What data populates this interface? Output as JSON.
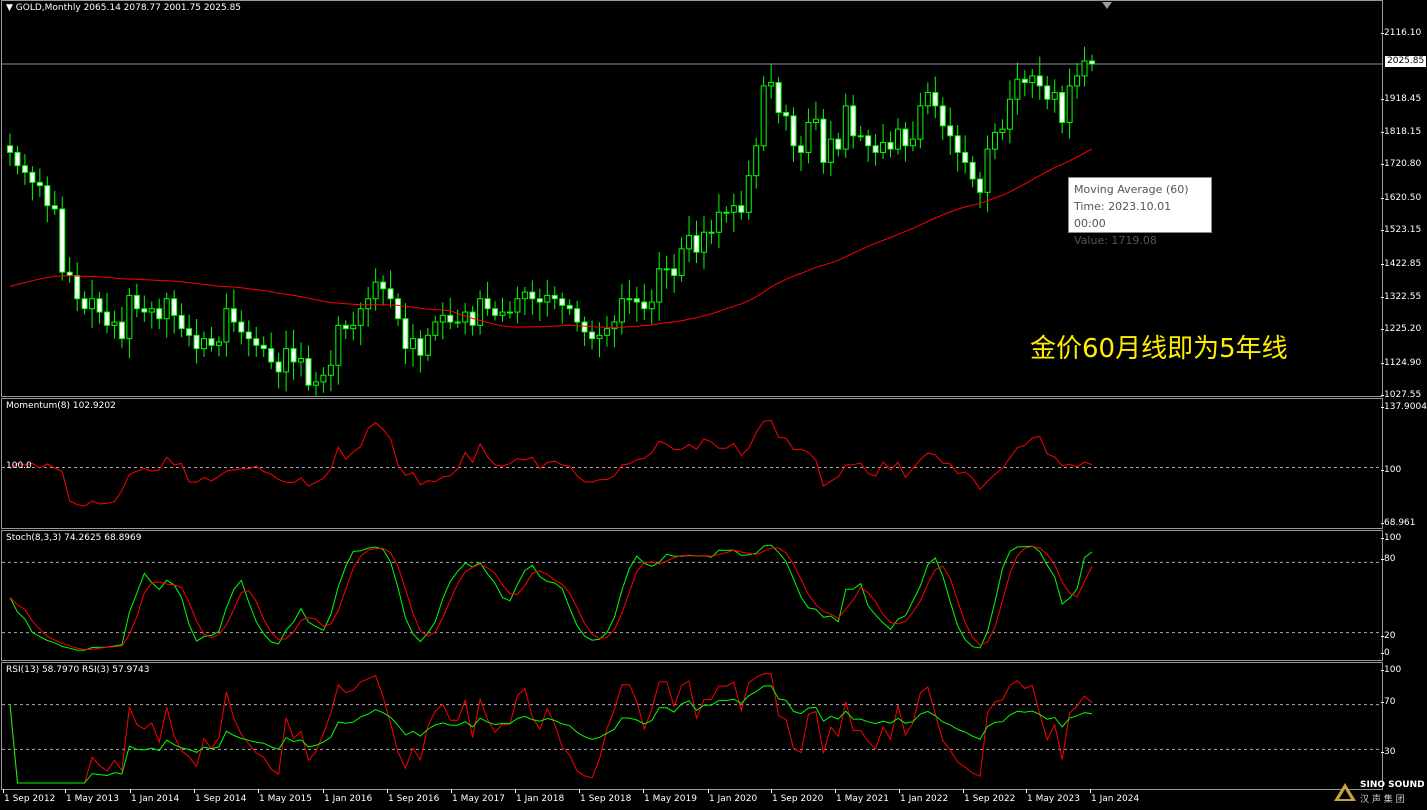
{
  "main": {
    "symbol_label": "GOLD,Monthly",
    "ohlc_label": "2065.14 2078.77 2001.75 2025.85",
    "current_price": "2025.85",
    "price_ticks": [
      "2116.10",
      "1918.45",
      "1818.15",
      "1720.80",
      "1620.50",
      "1523.15",
      "1422.85",
      "1322.55",
      "1225.20",
      "1124.90",
      "1027.55"
    ],
    "tooltip": {
      "line1": "Moving Average (60)",
      "line2": "Time: 2023.10.01 00:00",
      "line3": "Value: 1719.08"
    },
    "annotation": "金价60月线即为5年线"
  },
  "momentum": {
    "label": "Momentum(8) 102.9202",
    "ref_label": "100.0",
    "ticks": [
      "137.9004",
      "100",
      "68.961"
    ]
  },
  "stoch": {
    "label": "Stoch(8,3,3) 74.2625 68.8969",
    "ticks": [
      "100",
      "80",
      "20",
      "0"
    ]
  },
  "rsi": {
    "label": "RSI(13) 58.7970  RSI(3) 57.9743",
    "ticks": [
      "100",
      "70",
      "30"
    ]
  },
  "xaxis": {
    "labels": [
      "1 Sep 2012",
      "1 May 2013",
      "1 Jan 2014",
      "1 Sep 2014",
      "1 May 2015",
      "1 Jan 2016",
      "1 Sep 2016",
      "1 May 2017",
      "1 Jan 2018",
      "1 Sep 2018",
      "1 May 2019",
      "1 Jan 2020",
      "1 Sep 2020",
      "1 May 2021",
      "1 Jan 2022",
      "1 Sep 2022",
      "1 May 2023",
      "1 Jan 2024"
    ]
  },
  "logo": {
    "line1": "SINO SOUND",
    "line2": "汉 声 集 团"
  },
  "colors": {
    "bull": "#00ff00",
    "ma": "#ff0000",
    "green_line": "#00ff00",
    "red_line": "#ff0000",
    "annotation": "#ffee00"
  },
  "chart_data": {
    "type": "candlestick",
    "timeframe": "monthly",
    "closes": [
      1760,
      1720,
      1700,
      1670,
      1660,
      1600,
      1590,
      1400,
      1390,
      1320,
      1290,
      1320,
      1280,
      1240,
      1250,
      1200,
      1330,
      1290,
      1280,
      1290,
      1260,
      1320,
      1270,
      1230,
      1210,
      1170,
      1200,
      1180,
      1190,
      1290,
      1250,
      1220,
      1200,
      1180,
      1170,
      1130,
      1100,
      1170,
      1130,
      1140,
      1060,
      1070,
      1090,
      1120,
      1240,
      1230,
      1240,
      1290,
      1320,
      1370,
      1350,
      1320,
      1260,
      1170,
      1200,
      1150,
      1210,
      1250,
      1270,
      1250,
      1250,
      1280,
      1240,
      1320,
      1290,
      1270,
      1280,
      1280,
      1320,
      1340,
      1320,
      1310,
      1330,
      1320,
      1300,
      1290,
      1250,
      1220,
      1200,
      1210,
      1230,
      1250,
      1320,
      1320,
      1310,
      1290,
      1310,
      1410,
      1410,
      1390,
      1470,
      1510,
      1460,
      1520,
      1520,
      1580,
      1580,
      1600,
      1580,
      1690,
      1780,
      1960,
      1970,
      1880,
      1870,
      1780,
      1760,
      1850,
      1860,
      1730,
      1800,
      1770,
      1900,
      1810,
      1810,
      1780,
      1760,
      1790,
      1770,
      1830,
      1780,
      1800,
      1900,
      1940,
      1900,
      1840,
      1810,
      1760,
      1730,
      1680,
      1640,
      1770,
      1820,
      1830,
      1920,
      1980,
      1970,
      1990,
      1960,
      1920,
      1940,
      1850,
      1960,
      1990,
      2035,
      2025.85
    ],
    "ma60": {
      "name": "Moving Average (60)",
      "last": 1719.08
    },
    "momentum": {
      "period": 8,
      "last": 102.9202,
      "range": [
        68.961,
        137.9004
      ]
    },
    "stochastic": {
      "params": "8,3,3",
      "k_last": 74.2625,
      "d_last": 68.8969,
      "levels": [
        20,
        80
      ]
    },
    "rsi": {
      "periods": [
        13,
        3
      ],
      "rsi13_last": 58.797,
      "rsi3_last": 57.9743,
      "levels": [
        30,
        70
      ]
    }
  }
}
